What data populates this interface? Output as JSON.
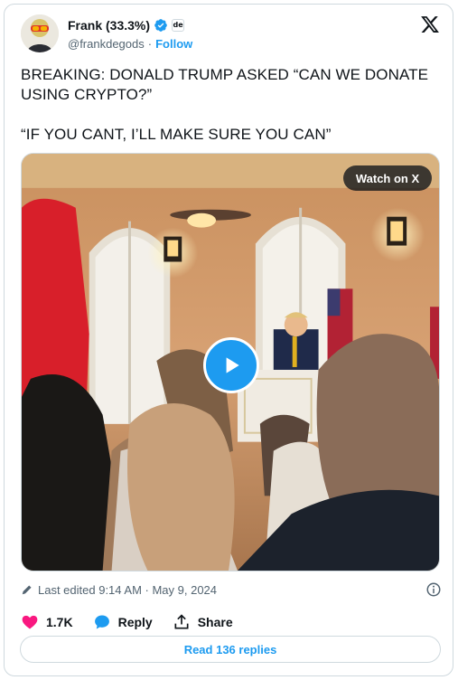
{
  "author": {
    "display_name": "Frank (33.3%)",
    "handle": "@frankdegods",
    "separator": "·",
    "follow_label": "Follow",
    "affiliate_badge": "de",
    "verified": true
  },
  "tweet": {
    "lines": [
      "BREAKING: DONALD TRUMP ASKED “CAN WE DONATE USING CRYPTO?”",
      "“IF YOU CANT, I’LL MAKE SURE YOU CAN”"
    ]
  },
  "media": {
    "watch_label": "Watch on X",
    "play_icon": "play-icon"
  },
  "meta": {
    "edited_text": "Last edited 9:14 AM · May 9, 2024"
  },
  "actions": {
    "like_count": "1.7K",
    "reply_label": "Reply",
    "share_label": "Share"
  },
  "replies_button": "Read 136 replies",
  "colors": {
    "accent": "#1d9bf0",
    "like": "#f91880",
    "text": "#0f1419",
    "secondary": "#536471",
    "border": "#cfd9de"
  }
}
